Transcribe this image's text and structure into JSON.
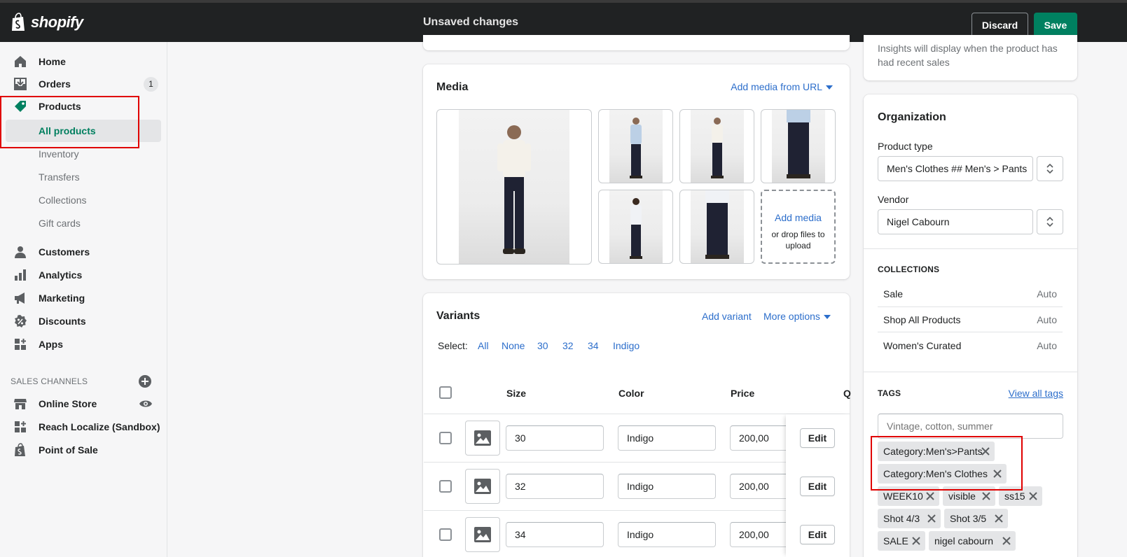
{
  "topbar": {
    "brand": "shopify",
    "status": "Unsaved changes",
    "discard_label": "Discard",
    "save_label": "Save"
  },
  "sidebar": {
    "items": [
      {
        "label": "Home",
        "icon": "home-icon"
      },
      {
        "label": "Orders",
        "icon": "orders-icon",
        "badge": "1"
      },
      {
        "label": "Products",
        "icon": "tag-icon"
      },
      {
        "label": "All products"
      },
      {
        "label": "Inventory"
      },
      {
        "label": "Transfers"
      },
      {
        "label": "Collections"
      },
      {
        "label": "Gift cards"
      },
      {
        "label": "Customers",
        "icon": "person-icon"
      },
      {
        "label": "Analytics",
        "icon": "bar-chart-icon"
      },
      {
        "label": "Marketing",
        "icon": "megaphone-icon"
      },
      {
        "label": "Discounts",
        "icon": "discount-icon"
      },
      {
        "label": "Apps",
        "icon": "apps-icon"
      }
    ],
    "channels_title": "SALES CHANNELS",
    "channels": [
      {
        "label": "Online Store",
        "icon": "store-icon"
      },
      {
        "label": "Reach Localize (Sandbox)",
        "icon": "apps-icon"
      },
      {
        "label": "Point of Sale",
        "icon": "shopify-bag-icon"
      }
    ]
  },
  "media": {
    "title": "Media",
    "add_from_url": "Add media from URL",
    "add_media": "Add media",
    "drop_hint": "or drop files to upload"
  },
  "variants": {
    "title": "Variants",
    "add_variant": "Add variant",
    "more_options": "More options",
    "select_label": "Select:",
    "select_options": [
      "All",
      "None",
      "30",
      "32",
      "34",
      "Indigo"
    ],
    "columns": [
      "Size",
      "Color",
      "Price",
      "Q"
    ],
    "rows": [
      {
        "size": "30",
        "color": "Indigo",
        "price": "200,00",
        "edit": "Edit"
      },
      {
        "size": "32",
        "color": "Indigo",
        "price": "200,00",
        "edit": "Edit"
      },
      {
        "size": "34",
        "color": "Indigo",
        "price": "200,00",
        "edit": "Edit"
      }
    ]
  },
  "insights": {
    "text": "Insights will display when the product has had recent sales"
  },
  "organization": {
    "title": "Organization",
    "product_type_label": "Product type",
    "product_type_value": "Men's Clothes ## Men's > Pants",
    "vendor_label": "Vendor",
    "vendor_value": "Nigel Cabourn",
    "collections_title": "COLLECTIONS",
    "collections": [
      {
        "name": "Sale",
        "mode": "Auto"
      },
      {
        "name": "Shop All Products",
        "mode": "Auto"
      },
      {
        "name": "Women's Curated",
        "mode": "Auto"
      }
    ],
    "tags_title": "TAGS",
    "view_all_tags": "View all tags",
    "tags_placeholder": "Vintage, cotton, summer",
    "tags": [
      "Category:Men's>Pants",
      "Category:Men's Clothes",
      "WEEK10",
      "visible",
      "ss15",
      "Shot 4/3",
      "Shot 3/5",
      "SALE",
      "nigel cabourn"
    ]
  },
  "colors": {
    "accent_green": "#008060",
    "link_blue": "#2c6ecb",
    "highlight_red": "#e00000"
  }
}
